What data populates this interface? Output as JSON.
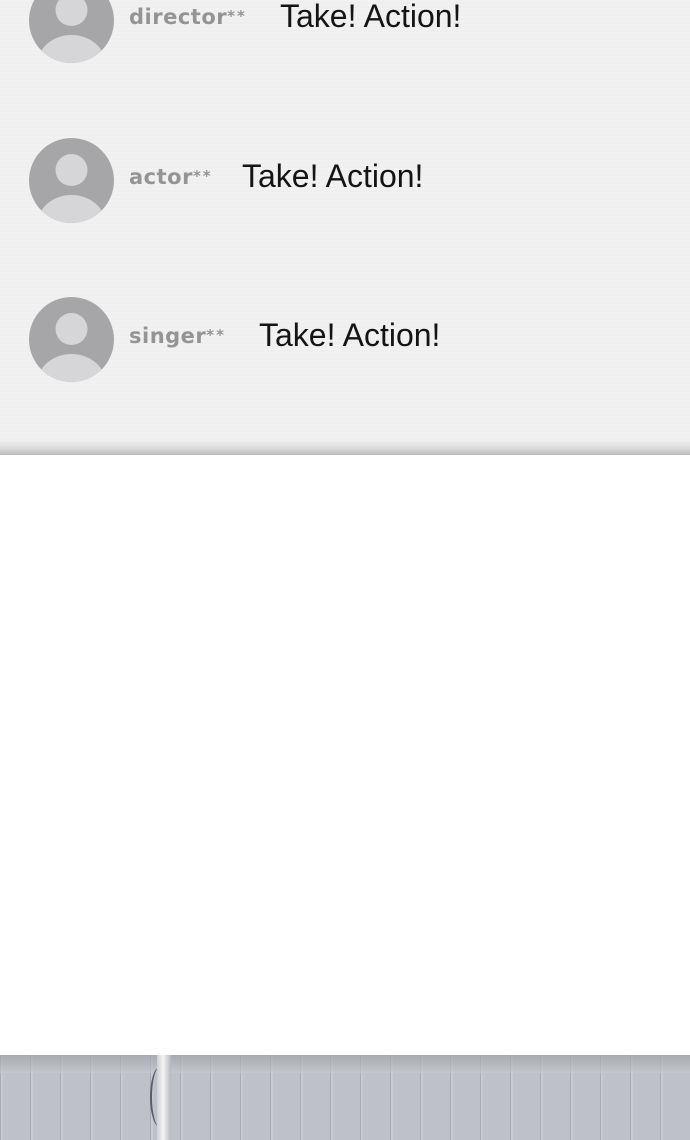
{
  "comments": [
    {
      "username": "director",
      "mask": "**",
      "text": "Take! Action!"
    },
    {
      "username": "actor",
      "mask": "**",
      "text": "Take! Action!"
    },
    {
      "username": "singer",
      "mask": "**",
      "text": "Take! Action!"
    }
  ],
  "colors": {
    "panel_background": "#f1f1f2",
    "avatar_background": "#a6a6a8",
    "avatar_silhouette": "#d6d6d8",
    "username": "#949496",
    "comment_text": "#141414",
    "page_background": "#ffffff"
  },
  "icons": {
    "avatar": "default-user-avatar-icon"
  }
}
